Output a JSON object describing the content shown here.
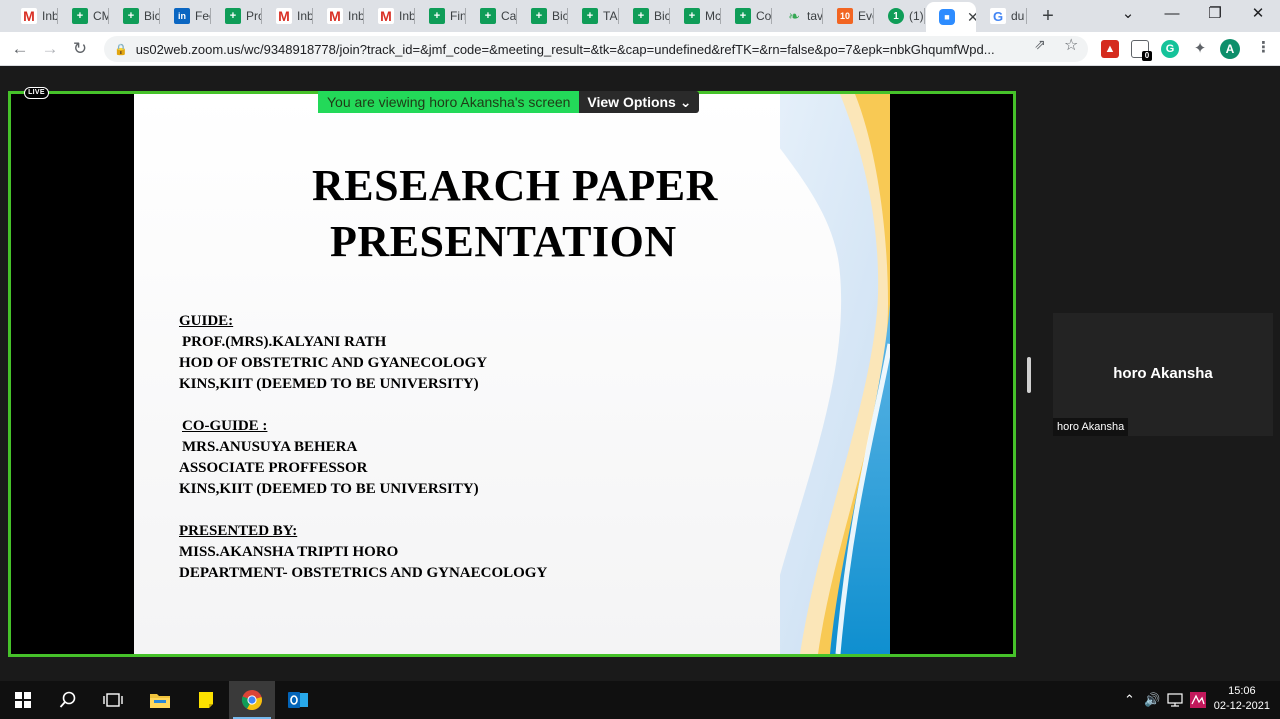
{
  "browser": {
    "tabs": [
      {
        "favicon": "gmail",
        "glyph": "M",
        "label": "Inb"
      },
      {
        "favicon": "sheet",
        "glyph": "+",
        "label": "CM"
      },
      {
        "favicon": "sheet",
        "glyph": "+",
        "label": "Bic"
      },
      {
        "favicon": "linkedin",
        "glyph": "in",
        "label": "Fee"
      },
      {
        "favicon": "sheet",
        "glyph": "+",
        "label": "Pro"
      },
      {
        "favicon": "gmail",
        "glyph": "M",
        "label": "Inb"
      },
      {
        "favicon": "gmail",
        "glyph": "M",
        "label": "Inb"
      },
      {
        "favicon": "gmail",
        "glyph": "M",
        "label": "Inb"
      },
      {
        "favicon": "sheet",
        "glyph": "+",
        "label": "Fin"
      },
      {
        "favicon": "sheet",
        "glyph": "+",
        "label": "Ca"
      },
      {
        "favicon": "sheet",
        "glyph": "+",
        "label": "Bic"
      },
      {
        "favicon": "sheet",
        "glyph": "+",
        "label": "TA"
      },
      {
        "favicon": "sheet",
        "glyph": "+",
        "label": "Bic"
      },
      {
        "favicon": "sheet",
        "glyph": "+",
        "label": "Mc"
      },
      {
        "favicon": "sheet",
        "glyph": "+",
        "label": "Co"
      },
      {
        "favicon": "leaf",
        "glyph": "❧",
        "label": "tav"
      },
      {
        "favicon": "num",
        "glyph": "10",
        "label": "Eve"
      },
      {
        "favicon": "one",
        "glyph": "1",
        "label": "(1)"
      },
      {
        "favicon": "zoom",
        "glyph": "■",
        "label": ""
      },
      {
        "favicon": "google",
        "glyph": "G",
        "label": "du"
      }
    ],
    "active_tab_close": "✕",
    "new_tab": "+",
    "window_controls": {
      "dropdown": "⌄",
      "minimize": "—",
      "maximize": "❐",
      "close": "✕"
    },
    "url": "us02web.zoom.us/wc/9348918778/join?track_id=&jmf_code=&meeting_result=&tk=&cap=undefined&refTK=&rn=false&po=7&epk=nbkGhqumfWpd...",
    "extensions": {
      "pdf": "▲",
      "badge": "0",
      "grammarly": "G",
      "avatar": "A"
    }
  },
  "meeting": {
    "live_badge": "LIVE",
    "viewing_banner": "You are viewing horo Akansha's screen",
    "view_options": "View Options ⌄",
    "participant_big_name": "horo Akansha",
    "participant_label": "horo Akansha"
  },
  "slide": {
    "title_line1": "RESEARCH PAPER",
    "title_line2": "PRESENTATION",
    "guide_heading": "GUIDE:",
    "guide_name": "PROF.(MRS).KALYANI RATH",
    "guide_role": "HOD OF OBSTETRIC AND GYANECOLOGY",
    "guide_org": "KINS,KIIT (DEEMED TO BE UNIVERSITY)",
    "coguide_heading": "CO-GUIDE :",
    "coguide_name": "MRS.ANUSUYA BEHERA",
    "coguide_role": "ASSOCIATE PROFFESSOR",
    "coguide_org": "KINS,KIIT (DEEMED TO BE UNIVERSITY)",
    "presenter_heading": "PRESENTED BY:",
    "presenter_name": "MISS.AKANSHA TRIPTI HORO",
    "presenter_dept": "DEPARTMENT- OBSTETRICS AND GYNAECOLOGY"
  },
  "taskbar": {
    "time": "15:06",
    "date": "02-12-2021"
  },
  "colors": {
    "share_border": "#46c22a",
    "banner_green": "#23d959",
    "wave_blue": "#1b9ad6",
    "wave_gold": "#f7c342"
  }
}
